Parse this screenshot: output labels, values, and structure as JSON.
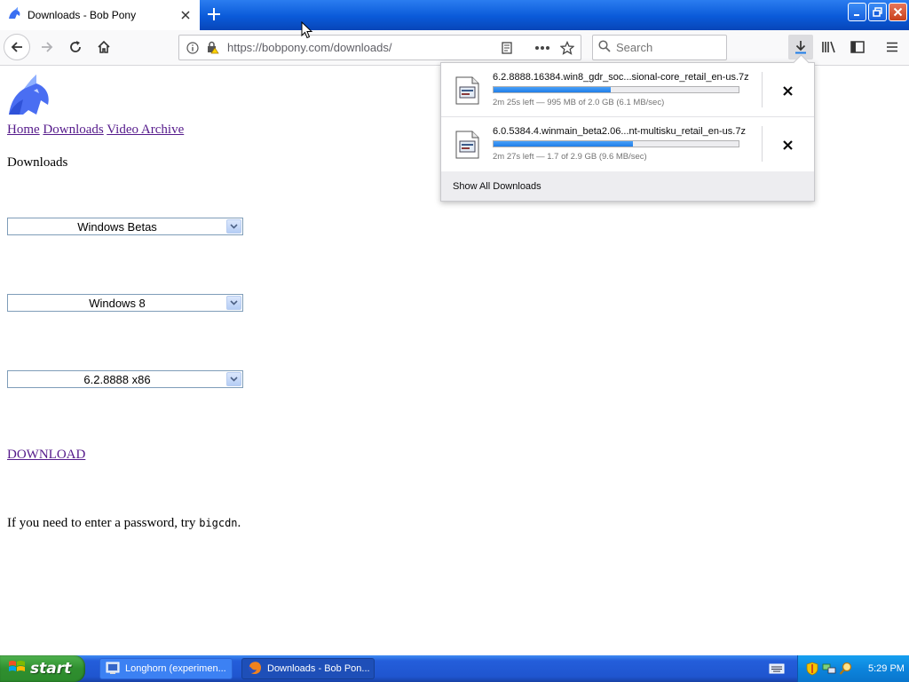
{
  "browser": {
    "tab_title": "Downloads - Bob Pony",
    "url": "https://bobpony.com/downloads/",
    "search_placeholder": "Search"
  },
  "page": {
    "nav_links": [
      "Home",
      "Downloads",
      "Video Archive"
    ],
    "heading": "Downloads",
    "selects": {
      "category": "Windows Betas",
      "product": "Windows 8",
      "build": "6.2.8888 x86"
    },
    "download_label": "DOWNLOAD",
    "password_prefix": "If you need to enter a password, try",
    "password_value": "bigcdn",
    "password_suffix": "."
  },
  "downloads_panel": {
    "items": [
      {
        "name": "6.2.8888.16384.win8_gdr_soc...sional-core_retail_en-us.7z",
        "status": "2m 25s left — 995 MB of 2.0 GB (6.1 MB/sec)",
        "progress": 0.48
      },
      {
        "name": "6.0.5384.4.winmain_beta2.06...nt-multisku_retail_en-us.7z",
        "status": "2m 27s left — 1.7 of 2.9 GB (9.6 MB/sec)",
        "progress": 0.57
      }
    ],
    "show_all_label": "Show All Downloads"
  },
  "taskbar": {
    "start_label": "start",
    "tasks": [
      {
        "label": "Longhorn (experimen...",
        "icon": "vm-icon",
        "active": false
      },
      {
        "label": "Downloads - Bob Pon...",
        "icon": "firefox-icon",
        "active": true
      }
    ],
    "clock": "5:29 PM"
  },
  "colors": {
    "titlebar": "#0a5ad9",
    "link_visited": "#551a8b",
    "progress_fill": "#1f7ee8",
    "start_green": "#2f8f2f",
    "taskbar_blue": "#245edb"
  }
}
